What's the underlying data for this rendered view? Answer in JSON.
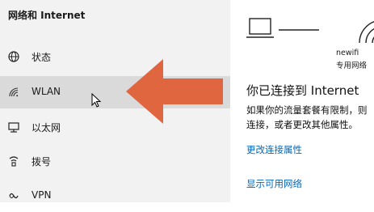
{
  "sidebar": {
    "section_title": "网络和 Internet",
    "items": [
      {
        "label": "状态",
        "icon": "globe-icon"
      },
      {
        "label": "WLAN",
        "icon": "wifi-icon"
      },
      {
        "label": "以太网",
        "icon": "ethernet-icon"
      },
      {
        "label": "拨号",
        "icon": "dialup-icon"
      },
      {
        "label": "VPN",
        "icon": "vpn-icon"
      }
    ],
    "active_item": "WLAN"
  },
  "annotation": {
    "arrow_color": "#e0663f",
    "arrow_icon": "left-arrow-icon"
  },
  "content": {
    "network_name": "newifi",
    "network_type": "专用网络",
    "status_title": "你已连接到 Internet",
    "desc_line1": "如果你的流量套餐有限制，则",
    "desc_line2": "连接，或者更改其他属性。",
    "link_change_props": "更改连接属性",
    "link_show_networks": "显示可用网络"
  },
  "colors": {
    "accent": "#0067b8",
    "sidebar_bg": "#f2f2f2",
    "active_bg": "#dadada"
  }
}
